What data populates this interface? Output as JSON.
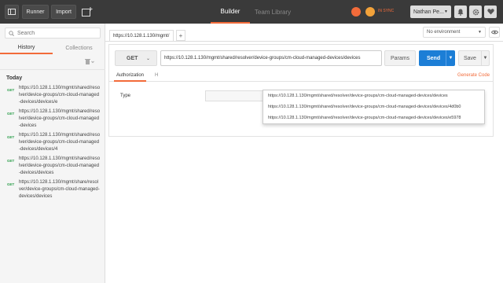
{
  "topbar": {
    "runner_label": "Runner",
    "import_label": "Import",
    "tabs": [
      {
        "label": "Builder",
        "active": true
      },
      {
        "label": "Team Library",
        "active": false
      }
    ],
    "sync_text": "IN SYNC",
    "user_label": "Nathan Pe..."
  },
  "sidebar": {
    "search_placeholder": "Search",
    "tabs": [
      {
        "label": "History",
        "active": true
      },
      {
        "label": "Collections",
        "active": false
      }
    ],
    "day_label": "Today",
    "history": [
      {
        "method": "GET",
        "text": "https://10.128.1.130/mgmt/shared/resolver/device-groups/cm-cloud-managed-devices/devices/e"
      },
      {
        "method": "GET",
        "text": "https://10.128.1.130/mgmt/shared/resolver/device-groups/cm-cloud-managed-devices"
      },
      {
        "method": "GET",
        "text": "https://10.128.1.130/mgmt/shared/resolver/device-groups/cm-cloud-managed-devices/devices/4"
      },
      {
        "method": "GET",
        "text": "https://10.128.1.130/mgmt/shared/resolver/device-groups/cm-cloud-managed-devices/devices"
      },
      {
        "method": "GET",
        "text": "https://10.128.1.130/mgmt/share/resolver/device-groups/cm-cloud-managed-devices/devices"
      }
    ]
  },
  "main": {
    "request_tab_label": "https://10.128.1.130/mgmt/",
    "add_tab_label": "+",
    "environment": "No environment",
    "method": "GET",
    "url": "https://10.128.1.130/mgmt/shared/resolver/device-groups/cm-cloud-managed-devices/devices",
    "params_label": "Params",
    "send_label": "Send",
    "save_label": "Save",
    "subtabs": {
      "authorization": "Authorization",
      "headers_partial": "H",
      "generate_code": "Generate Code"
    },
    "type_label": "Type",
    "suggestions": [
      "https://10.128.1.130/mgmt/shared/resolver/device-groups/cm-cloud-managed-devices/devices",
      "https://10.128.1.130/mgmt/shared/resolver/device-groups/cm-cloud-managed-devices/devices/4d0b0",
      "https://10.128.1.130/mgmt/shared/resolver/device-groups/cm-cloud-managed-devices/devices/e5978"
    ]
  },
  "colors": {
    "accent": "#f26b3a",
    "send": "#1c7ed6",
    "topbar": "#3a3a3a",
    "get_method": "#2b9e4a"
  },
  "icons": [
    "sidebar-toggle-icon",
    "new-window-icon",
    "sync-status-icon",
    "bell-icon",
    "gear-icon",
    "heart-icon",
    "search-icon",
    "trash-icon",
    "eye-icon",
    "chevron-down-icon"
  ]
}
